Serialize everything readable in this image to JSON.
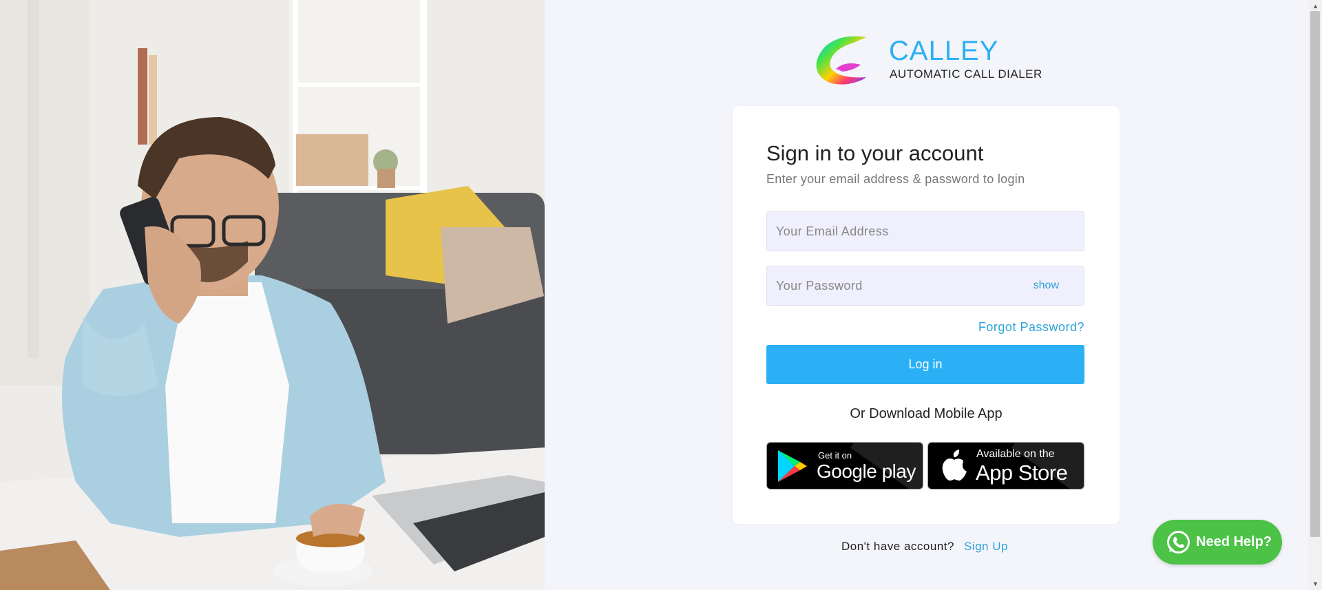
{
  "brand": {
    "name": "CALLEY",
    "tagline": "AUTOMATIC CALL DIALER",
    "accent": "#2bb0f2"
  },
  "login": {
    "title": "Sign in to your account",
    "subtitle": "Enter your email address & password to login",
    "email_placeholder": "Your Email Address",
    "password_placeholder": "Your Password",
    "show_label": "show",
    "forgot_label": "Forgot Password?",
    "login_label": "Log in",
    "or_label": "Or Download Mobile App"
  },
  "stores": {
    "google": {
      "small": "Get it on",
      "big": "Google play"
    },
    "apple": {
      "small": "Available on the",
      "big": "App Store"
    }
  },
  "footer": {
    "prompt": "Don't have account?",
    "signup_label": "Sign Up"
  },
  "help": {
    "label": "Need Help?",
    "color": "#4cc247"
  },
  "icons": [
    "calley-logo-icon",
    "google-play-icon",
    "apple-icon",
    "whatsapp-icon"
  ]
}
